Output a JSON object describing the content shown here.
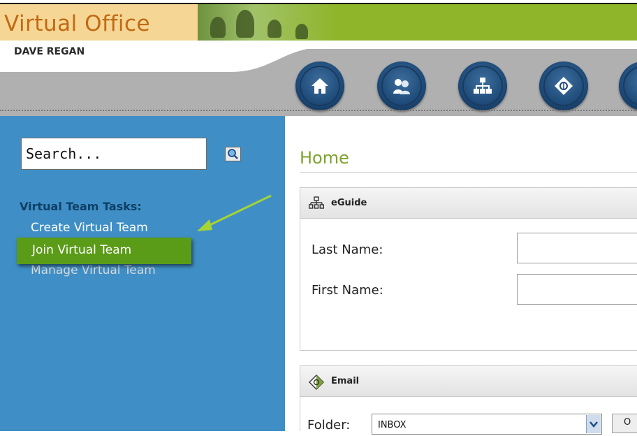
{
  "header": {
    "app_title": "Virtual Office",
    "user_name": "DAVE REGAN"
  },
  "nav": {
    "buttons": [
      {
        "icon": "home-icon"
      },
      {
        "icon": "team-icon"
      },
      {
        "icon": "hierarchy-icon"
      },
      {
        "icon": "email-icon"
      }
    ]
  },
  "sidebar": {
    "search": {
      "value": "Search..."
    },
    "tasks_title": "Virtual Team Tasks:",
    "tasks": [
      {
        "label": "Create Virtual Team"
      },
      {
        "label": "Join Virtual Team",
        "highlighted": true
      },
      {
        "label": "Manage Virtual Team"
      }
    ]
  },
  "main": {
    "title": "Home",
    "eguide": {
      "title": "eGuide",
      "last_name_label": "Last Name:",
      "first_name_label": "First Name:",
      "last_name_value": "",
      "first_name_value": ""
    },
    "email": {
      "title": "Email",
      "folder_label": "Folder:",
      "folder_value": "INBOX",
      "open_button_label": "O"
    }
  },
  "colors": {
    "header_green": "#8fb52a",
    "logo_bg": "#f6d695",
    "logo_text": "#c06a14",
    "sidebar_blue": "#3f8fc6",
    "highlight_green": "#5a9b18",
    "title_green": "#7da42b",
    "nav_button": "#1d4a78"
  }
}
